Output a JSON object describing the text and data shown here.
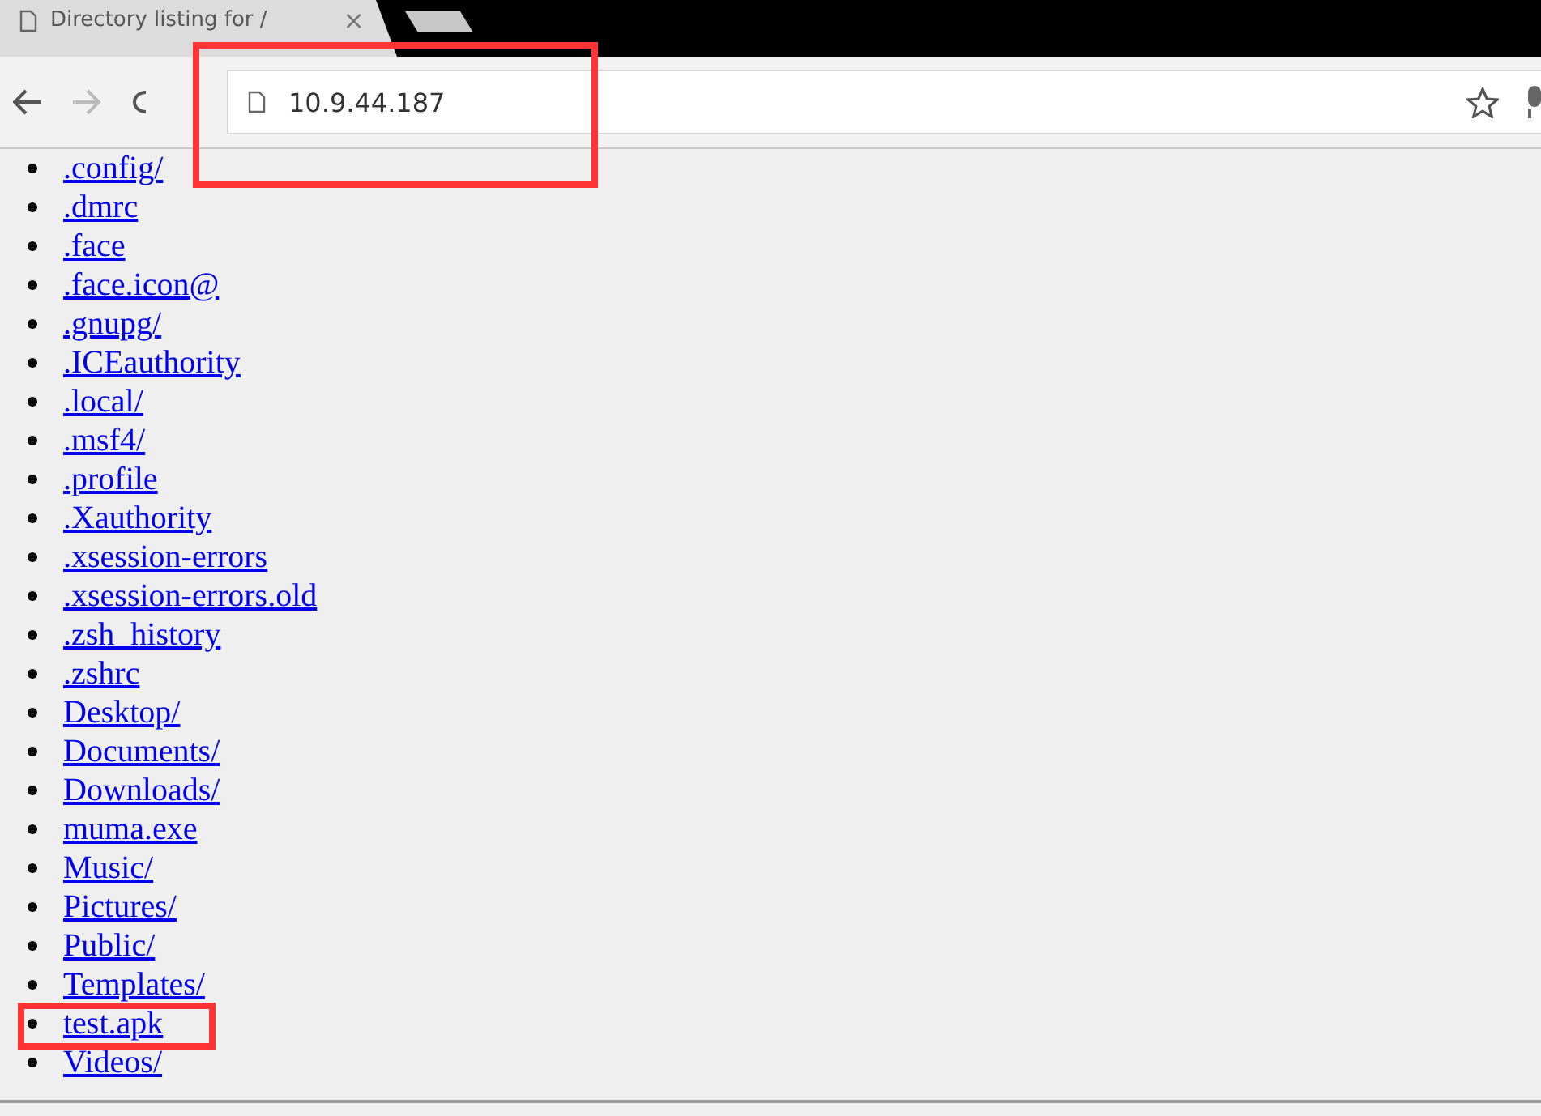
{
  "tab": {
    "title": "Directory listing for /",
    "close": "×"
  },
  "address_bar": {
    "url": "10.9.44.187",
    "highlighted": true
  },
  "listing": [
    {
      "name": ".config/",
      "highlighted": false
    },
    {
      "name": ".dmrc",
      "highlighted": false
    },
    {
      "name": ".face",
      "highlighted": false
    },
    {
      "name": ".face.icon@",
      "highlighted": false
    },
    {
      "name": ".gnupg/",
      "highlighted": false
    },
    {
      "name": ".ICEauthority",
      "highlighted": false
    },
    {
      "name": ".local/",
      "highlighted": false
    },
    {
      "name": ".msf4/",
      "highlighted": false
    },
    {
      "name": ".profile",
      "highlighted": false
    },
    {
      "name": ".Xauthority",
      "highlighted": false
    },
    {
      "name": ".xsession-errors",
      "highlighted": false
    },
    {
      "name": ".xsession-errors.old",
      "highlighted": false
    },
    {
      "name": ".zsh_history",
      "highlighted": false
    },
    {
      "name": ".zshrc",
      "highlighted": false
    },
    {
      "name": "Desktop/",
      "highlighted": false
    },
    {
      "name": "Documents/",
      "highlighted": false
    },
    {
      "name": "Downloads/",
      "highlighted": false
    },
    {
      "name": "muma.exe",
      "highlighted": false
    },
    {
      "name": "Music/",
      "highlighted": false
    },
    {
      "name": "Pictures/",
      "highlighted": false
    },
    {
      "name": "Public/",
      "highlighted": false
    },
    {
      "name": "Templates/",
      "highlighted": false
    },
    {
      "name": "test.apk",
      "highlighted": true
    },
    {
      "name": "Videos/",
      "highlighted": false
    }
  ]
}
